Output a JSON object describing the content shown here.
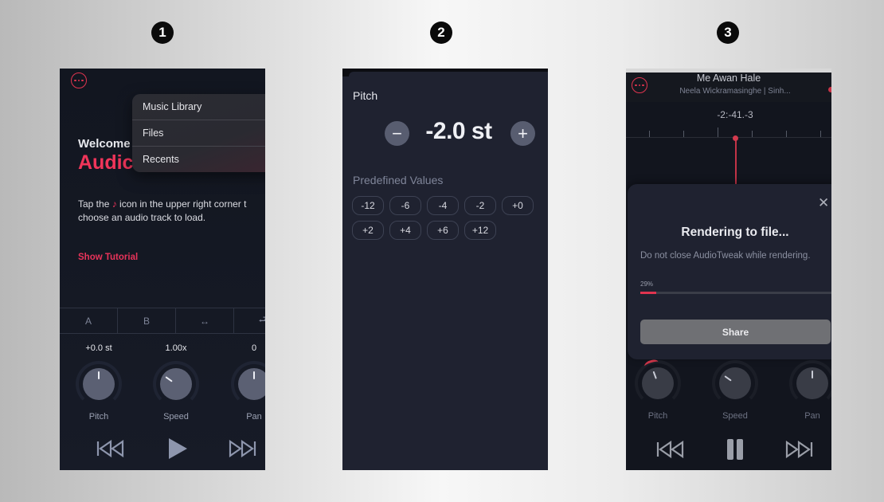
{
  "steps": [
    "1",
    "2",
    "3"
  ],
  "panel1": {
    "menu_icon": "more-horizontal-circle-icon",
    "welcome": "Welcome",
    "app_name": "Audic",
    "menu_items": [
      {
        "label": "Music Library"
      },
      {
        "label": "Files"
      },
      {
        "label": "Recents"
      }
    ],
    "help_before": "Tap the ",
    "help_icon": "music-note-icon",
    "help_icon_glyph": "♪",
    "help_after_line1": " icon in the upper right corner t",
    "help_line2": "choose an audio track to load.",
    "show_tutorial": "Show Tutorial",
    "ab_bar": [
      "A",
      "B",
      "↔",
      "⮐"
    ],
    "knobs": [
      {
        "label": "Pitch",
        "value": "+0.0 st",
        "rotation_deg": 0
      },
      {
        "label": "Speed",
        "value": "1.00x",
        "rotation_deg": -55
      },
      {
        "label": "Pan",
        "value": "0",
        "rotation_deg": 0
      }
    ],
    "transport": {
      "rewind": "skip-back-icon",
      "play": "play-icon",
      "forward": "skip-forward-icon"
    }
  },
  "panel2": {
    "title": "Pitch",
    "minus": "−",
    "plus": "+",
    "value": "-2.0 st",
    "predefined_title": "Predefined Values",
    "predefined": [
      "-12",
      "-6",
      "-4",
      "-2",
      "+0",
      "+2",
      "+4",
      "+6",
      "+12"
    ]
  },
  "panel3": {
    "track_title": "Me Awan Hale",
    "track_subtitle": "Neela Wickramasinghe | Sinh...",
    "time": "-2:-41.-3",
    "dialog": {
      "close": "✕",
      "title": "Rendering to file...",
      "message": "Do not close AudioTweak while rendering.",
      "progress_label": "29%",
      "progress": 0.29,
      "share": "Share"
    },
    "knobs": [
      {
        "label": "Pitch",
        "rotation_deg": -20
      },
      {
        "label": "Speed",
        "rotation_deg": -55
      },
      {
        "label": "Pan",
        "rotation_deg": 0
      }
    ],
    "transport": {
      "rewind": "skip-back-icon",
      "pause": "pause-icon",
      "forward": "skip-forward-icon"
    }
  },
  "colors": {
    "accent": "#f0355a",
    "panel_bg": "#151925",
    "knob": "#5b6073"
  }
}
